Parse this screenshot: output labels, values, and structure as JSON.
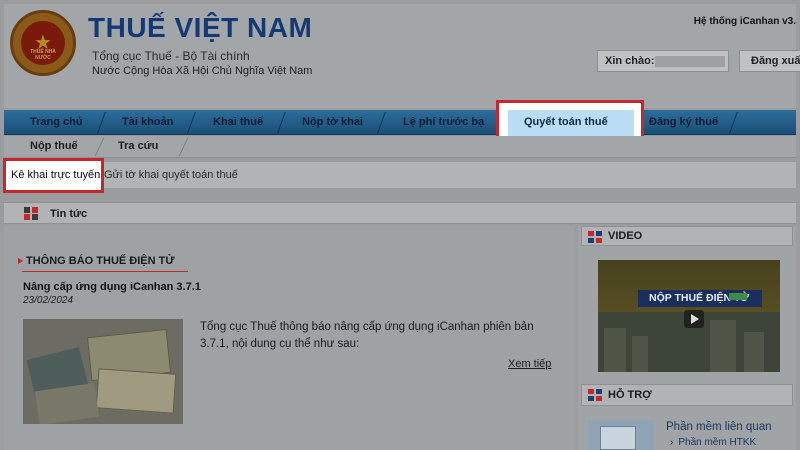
{
  "header": {
    "title": "THUẾ VIỆT NAM",
    "subtitle1": "Tổng cục Thuế - Bộ Tài chính",
    "subtitle2": "Nước Cộng Hòa Xã Hội Chủ Nghĩa Việt Nam",
    "system_label": "Hệ thống iCanhan v3.",
    "greeting": "Xin chào:",
    "logout": "Đăng xuấ",
    "logo_text": "THUẾ NHÀ NƯỚC"
  },
  "nav": {
    "items": [
      {
        "label": "Trang chủ"
      },
      {
        "label": "Tài khoản"
      },
      {
        "label": "Khai thuế"
      },
      {
        "label": "Nộp tờ khai"
      },
      {
        "label": "Lệ phí trước bạ"
      },
      {
        "label": "Quyết toán thuế"
      },
      {
        "label": "Đăng ký thuế"
      }
    ],
    "active_index": 5
  },
  "subnav": {
    "items": [
      {
        "label": "Nộp thuế"
      },
      {
        "label": "Tra cứu"
      }
    ]
  },
  "crumbs": {
    "active": "Kê khai trực tuyến",
    "other": "Gửi tờ khai quyết toán thuế"
  },
  "news": {
    "label": "Tin tức",
    "section_title": "THÔNG BÁO THUẾ ĐIỆN TỬ",
    "article_title": "Nâng cấp ứng dụng iCanhan 3.7.1",
    "article_date": "23/02/2024",
    "excerpt": "Tổng cục Thuế thông báo nâng cấp ứng dụng iCanhan phiên bản 3.7.1, nội dung cụ thể như sau:",
    "read_more": "Xem tiếp"
  },
  "sidebar": {
    "video_label": "VIDEO",
    "video_banner": "NỘP THUẾ ĐIỆN TỬ",
    "support_label": "HỖ TRỢ",
    "software_title": "Phần mềm liên quan",
    "software_item": "Phần mềm HTKK"
  },
  "colors": {
    "highlight_border": "#c8262d",
    "nav_blue": "#1b4f78",
    "title_blue": "#143a74"
  }
}
